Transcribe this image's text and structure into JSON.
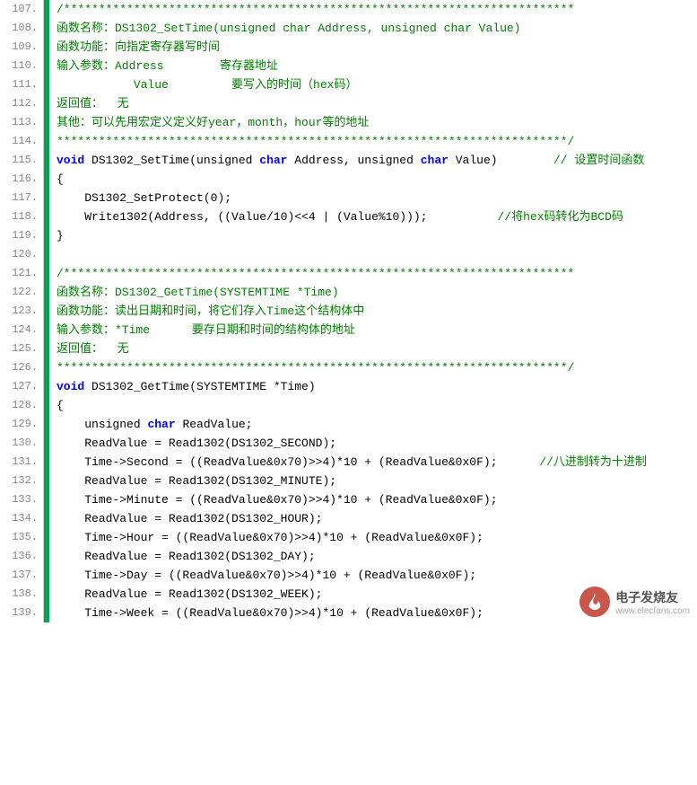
{
  "watermark": {
    "line1": "电子发烧友",
    "line2": "www.elecfans.com"
  },
  "lines": [
    {
      "num": "107.",
      "segs": [
        {
          "cls": "c-comment",
          "t": "/*************************************************************************"
        }
      ]
    },
    {
      "num": "108.",
      "segs": [
        {
          "cls": "c-comment",
          "t": "函数名称：DS1302_SetTime(unsigned char Address, unsigned char Value)"
        }
      ]
    },
    {
      "num": "109.",
      "segs": [
        {
          "cls": "c-comment",
          "t": "函数功能：向指定寄存器写时间"
        }
      ]
    },
    {
      "num": "110.",
      "segs": [
        {
          "cls": "c-comment",
          "t": "输入参数：Address        寄存器地址"
        }
      ]
    },
    {
      "num": "111.",
      "segs": [
        {
          "cls": "c-comment",
          "t": "           Value         要写入的时间（hex码）"
        }
      ]
    },
    {
      "num": "112.",
      "segs": [
        {
          "cls": "c-comment",
          "t": "返回值：  无"
        }
      ]
    },
    {
      "num": "113.",
      "segs": [
        {
          "cls": "c-comment",
          "t": "其他：可以先用宏定义定义好year，month，hour等的地址"
        }
      ]
    },
    {
      "num": "114.",
      "segs": [
        {
          "cls": "c-comment",
          "t": "*************************************************************************/"
        }
      ]
    },
    {
      "num": "115.",
      "segs": [
        {
          "cls": "c-keyword",
          "t": "void"
        },
        {
          "cls": "c-plain",
          "t": " DS1302_SetTime(unsigned "
        },
        {
          "cls": "c-type",
          "t": "char"
        },
        {
          "cls": "c-plain",
          "t": " Address, unsigned "
        },
        {
          "cls": "c-type",
          "t": "char"
        },
        {
          "cls": "c-plain",
          "t": " Value)        "
        },
        {
          "cls": "c-comment",
          "t": "// 设置时间函数"
        }
      ]
    },
    {
      "num": "116.",
      "segs": [
        {
          "cls": "c-plain",
          "t": "{"
        }
      ]
    },
    {
      "num": "117.",
      "segs": [
        {
          "cls": "c-plain",
          "t": "    DS1302_SetProtect(0);"
        }
      ]
    },
    {
      "num": "118.",
      "segs": [
        {
          "cls": "c-plain",
          "t": "    Write1302(Address, ((Value/10)<<4 | (Value%10)));          "
        },
        {
          "cls": "c-comment",
          "t": "//将hex码转化为BCD码"
        }
      ]
    },
    {
      "num": "119.",
      "segs": [
        {
          "cls": "c-plain",
          "t": "}"
        }
      ]
    },
    {
      "num": "120.",
      "segs": [
        {
          "cls": "c-plain",
          "t": " "
        }
      ]
    },
    {
      "num": "121.",
      "segs": [
        {
          "cls": "c-comment",
          "t": "/*************************************************************************"
        }
      ]
    },
    {
      "num": "122.",
      "segs": [
        {
          "cls": "c-comment",
          "t": "函数名称：DS1302_GetTime(SYSTEMTIME *Time)"
        }
      ]
    },
    {
      "num": "123.",
      "segs": [
        {
          "cls": "c-comment",
          "t": "函数功能：读出日期和时间，将它们存入Time这个结构体中"
        }
      ]
    },
    {
      "num": "124.",
      "segs": [
        {
          "cls": "c-comment",
          "t": "输入参数：*Time      要存日期和时间的结构体的地址"
        }
      ]
    },
    {
      "num": "125.",
      "segs": [
        {
          "cls": "c-comment",
          "t": "返回值：  无"
        }
      ]
    },
    {
      "num": "126.",
      "segs": [
        {
          "cls": "c-comment",
          "t": "*************************************************************************/"
        }
      ]
    },
    {
      "num": "127.",
      "segs": [
        {
          "cls": "c-keyword",
          "t": "void"
        },
        {
          "cls": "c-plain",
          "t": " DS1302_GetTime(SYSTEMTIME *Time)"
        }
      ]
    },
    {
      "num": "128.",
      "segs": [
        {
          "cls": "c-plain",
          "t": "{"
        }
      ]
    },
    {
      "num": "129.",
      "segs": [
        {
          "cls": "c-plain",
          "t": "    unsigned "
        },
        {
          "cls": "c-type",
          "t": "char"
        },
        {
          "cls": "c-plain",
          "t": " ReadValue;"
        }
      ]
    },
    {
      "num": "130.",
      "segs": [
        {
          "cls": "c-plain",
          "t": "    ReadValue = Read1302(DS1302_SECOND);"
        }
      ]
    },
    {
      "num": "131.",
      "segs": [
        {
          "cls": "c-plain",
          "t": "    Time->Second = ((ReadValue&0x70)>>4)*10 + (ReadValue&0x0F);      "
        },
        {
          "cls": "c-comment",
          "t": "//八进制转为十进制"
        }
      ]
    },
    {
      "num": "132.",
      "segs": [
        {
          "cls": "c-plain",
          "t": "    ReadValue = Read1302(DS1302_MINUTE);"
        }
      ]
    },
    {
      "num": "133.",
      "segs": [
        {
          "cls": "c-plain",
          "t": "    Time->Minute = ((ReadValue&0x70)>>4)*10 + (ReadValue&0x0F);"
        }
      ]
    },
    {
      "num": "134.",
      "segs": [
        {
          "cls": "c-plain",
          "t": "    ReadValue = Read1302(DS1302_HOUR);"
        }
      ]
    },
    {
      "num": "135.",
      "segs": [
        {
          "cls": "c-plain",
          "t": "    Time->Hour = ((ReadValue&0x70)>>4)*10 + (ReadValue&0x0F);"
        }
      ]
    },
    {
      "num": "136.",
      "segs": [
        {
          "cls": "c-plain",
          "t": "    ReadValue = Read1302(DS1302_DAY);"
        }
      ]
    },
    {
      "num": "137.",
      "segs": [
        {
          "cls": "c-plain",
          "t": "    Time->Day = ((ReadValue&0x70)>>4)*10 + (ReadValue&0x0F);"
        }
      ]
    },
    {
      "num": "138.",
      "segs": [
        {
          "cls": "c-plain",
          "t": "    ReadValue = Read1302(DS1302_WEEK);"
        }
      ]
    },
    {
      "num": "139.",
      "segs": [
        {
          "cls": "c-plain",
          "t": "    Time->Week = ((ReadValue&0x70)>>4)*10 + (ReadValue&0x0F);"
        }
      ]
    }
  ]
}
